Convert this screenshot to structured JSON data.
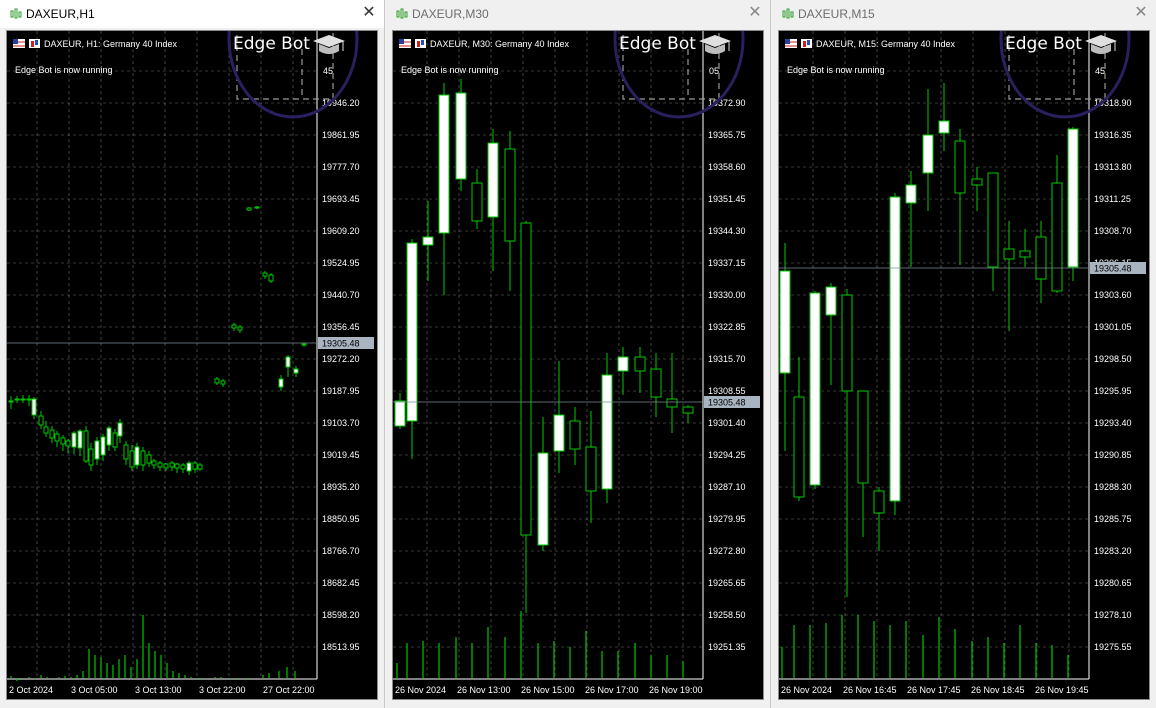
{
  "windows": [
    {
      "title": "DAXEUR,H1",
      "active": true,
      "symbol_label": "DAXEUR, H1:  Germany 40 Index",
      "ea_message": "Edge Bot is now running",
      "bot_label": "Edge Bot",
      "current_price": "19305.48",
      "price_labels": [
        "19946.20",
        "19861.95",
        "19777.70",
        "19693.45",
        "19609.20",
        "19524.95",
        "19440.70",
        "19356.45",
        "19272.20",
        "19187.95",
        "19103.70",
        "19019.45",
        "18935.20",
        "18850.95",
        "18766.70",
        "18682.45",
        "18598.20",
        "18513.95"
      ],
      "partial_top_label": "45",
      "time_labels": [
        "2 Oct 2024",
        "3 Oct 05:00",
        "3 Oct 13:00",
        "3 Oct 22:00",
        "27 Oct 22:00"
      ]
    },
    {
      "title": "DAXEUR,M30",
      "active": false,
      "symbol_label": "DAXEUR, M30:  Germany 40 Index",
      "ea_message": "Edge Bot is now running",
      "bot_label": "Edge Bot",
      "current_price": "19305.48",
      "price_labels": [
        "19372.90",
        "19365.75",
        "19358.60",
        "19351.45",
        "19344.30",
        "19337.15",
        "19330.00",
        "19322.85",
        "19315.70",
        "19308.55",
        "19301.40",
        "19294.25",
        "19287.10",
        "19279.95",
        "19272.80",
        "19265.65",
        "19258.50",
        "19251.35"
      ],
      "partial_top_label": "05",
      "time_labels": [
        "26 Nov 2024",
        "26 Nov 13:00",
        "26 Nov 15:00",
        "26 Nov 17:00",
        "26 Nov 19:00"
      ]
    },
    {
      "title": "DAXEUR,M15",
      "active": false,
      "symbol_label": "DAXEUR, M15:  Germany 40 Index",
      "ea_message": "Edge Bot is now running",
      "bot_label": "Edge Bot",
      "current_price": "19305.48",
      "price_labels": [
        "19318.90",
        "19316.35",
        "19313.80",
        "19311.25",
        "19308.70",
        "19306.15",
        "19303.60",
        "19301.05",
        "19298.50",
        "19295.95",
        "19293.40",
        "19290.85",
        "19288.30",
        "19285.75",
        "19283.20",
        "19280.65",
        "19278.10",
        "19275.55"
      ],
      "partial_top_label": "45",
      "time_labels": [
        "26 Nov 2024",
        "26 Nov 16:45",
        "26 Nov 17:45",
        "26 Nov 18:45",
        "26 Nov 19:45"
      ]
    }
  ],
  "colors": {
    "background": "#000000",
    "grid": "#c8c8c8",
    "bull_candle_body": "#ffffff",
    "candle_outline": "#00c800",
    "volume": "#00c800",
    "bid_line": "#7a8a9a",
    "bot_highlight_ring": "#2a2060",
    "title_icon": "#2e9e2e"
  },
  "icons": [
    "chart-window-icon",
    "close-icon",
    "flag-icon",
    "chart-type-icon",
    "graduation-cap-icon"
  ]
}
